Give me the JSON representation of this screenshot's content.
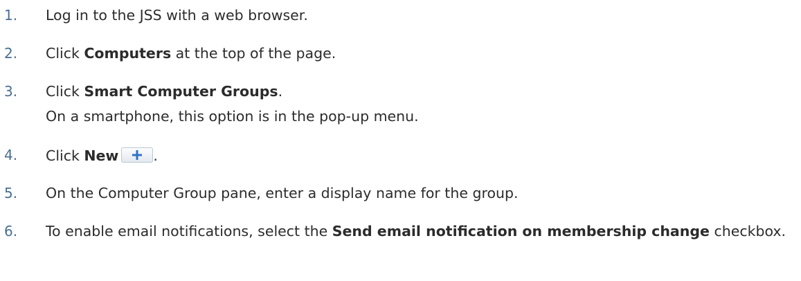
{
  "steps": [
    {
      "number": "1.",
      "text": "Log in to the JSS with a web browser."
    },
    {
      "number": "2.",
      "before": "Click ",
      "bold": "Computers",
      "after": " at the top of the page."
    },
    {
      "number": "3.",
      "before": "Click ",
      "bold": "Smart Computer Groups",
      "after": ".",
      "note": "On a smartphone, this option is in the pop-up menu."
    },
    {
      "number": "4.",
      "before": "Click ",
      "bold": "New",
      "after": ".",
      "icon": "plus-icon"
    },
    {
      "number": "5.",
      "text": "On the Computer Group pane, enter a display name for the group."
    },
    {
      "number": "6.",
      "before": "To enable email notifications, select the ",
      "bold": "Send email notification on membership change",
      "after": " checkbox."
    }
  ],
  "colors": {
    "number": "#4a6d92",
    "text": "#2b2b2b",
    "plus": "#2f74c6"
  }
}
